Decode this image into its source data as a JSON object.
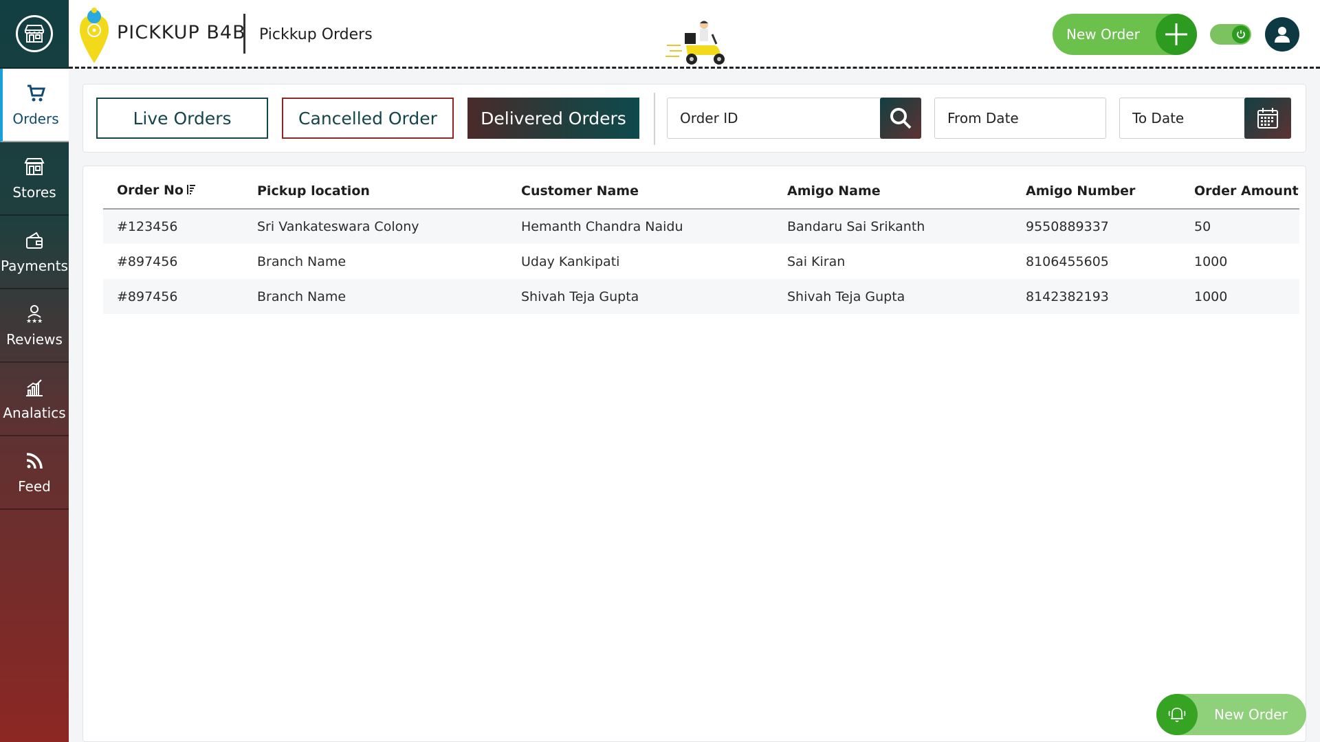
{
  "sidebar": {
    "items": [
      {
        "label": "Orders",
        "icon": "cart-icon"
      },
      {
        "label": "Stores",
        "icon": "store-icon"
      },
      {
        "label": "Payments",
        "icon": "wallet-icon"
      },
      {
        "label": "Reviews",
        "icon": "reviews-icon"
      },
      {
        "label": "Analatics",
        "icon": "analytics-icon"
      },
      {
        "label": "Feed",
        "icon": "rss-icon"
      }
    ]
  },
  "header": {
    "brand": "PICKKUP B4B",
    "title": "Pickkup Orders",
    "new_order_label": "New Order"
  },
  "filters": {
    "live": "Live Orders",
    "cancelled": "Cancelled Order",
    "delivered": "Delivered Orders",
    "order_id_placeholder": "Order ID",
    "from_date_placeholder": "From Date",
    "to_date_placeholder": "To Date"
  },
  "table": {
    "columns": [
      "Order No",
      "Pickup location",
      "Customer Name",
      "Amigo Name",
      "Amigo Number",
      "Order Amount"
    ],
    "rows": [
      [
        "#123456",
        "Sri Vankateswara Colony",
        "Hemanth Chandra Naidu",
        "Bandaru Sai Srikanth",
        "9550889337",
        "50"
      ],
      [
        "#897456",
        "Branch Name",
        "Uday Kankipati",
        "Sai Kiran",
        "8106455605",
        "1000"
      ],
      [
        "#897456",
        "Branch Name",
        "Shivah Teja Gupta",
        "Shivah Teja Gupta",
        "8142382193",
        "1000"
      ]
    ]
  },
  "fab": {
    "label": "New Order"
  },
  "colors": {
    "accent_green": "#6cc14d",
    "dark_teal": "#123f42",
    "maroon": "#8c2723",
    "active_blue": "#1aa0d8"
  }
}
